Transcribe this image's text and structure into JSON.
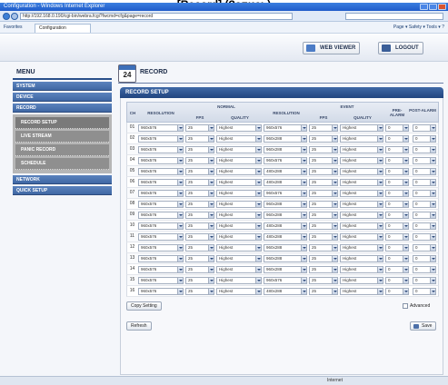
{
  "caption": "[Record] (Запись)",
  "browser": {
    "title": "Configuration - Windows Internet Explorer",
    "address": "http://192.168.0.190/cgi-bin/webra.fcgi?fwcmd=cfg&page=record",
    "favorites_label": "Favorites",
    "tab_label": "Configuration",
    "tools_label": "Page ▾  Safety ▾  Tools ▾  ?",
    "status_text": "Internet"
  },
  "topbar": {
    "web_viewer_label": "WEB VIEWER",
    "logout_label": "LOGOUT"
  },
  "sidebar": {
    "title": "MENU",
    "groups": [
      "SYSTEM",
      "DEVICE",
      "RECORD"
    ],
    "record_items": [
      "RECORD SETUP",
      "LIVE STREAM",
      "PANIC RECORD",
      "SCHEDULE"
    ],
    "after_groups": [
      "NETWORK",
      "QUICK SETUP"
    ]
  },
  "page": {
    "icon_number": "24",
    "title": "RECORD",
    "panel_title": "RECORD SETUP"
  },
  "table": {
    "headers": {
      "ch": "CH",
      "normal": "NORMAL",
      "event": "EVENT",
      "resolution": "RESOLUTION",
      "fps": "FPS",
      "quality": "QUALITY",
      "pre_alarm": "PRE-ALARM",
      "post_alarm": "POST-ALARM"
    },
    "rows": [
      {
        "ch": "01",
        "n_res": "960x576",
        "n_fps": "25",
        "n_q": "Highest",
        "e_res": "960x576",
        "e_fps": "25",
        "e_q": "Highest",
        "pre": "0",
        "post": "0"
      },
      {
        "ch": "02",
        "n_res": "960x576",
        "n_fps": "25",
        "n_q": "Highest",
        "e_res": "960x288",
        "e_fps": "25",
        "e_q": "Highest",
        "pre": "0",
        "post": "0"
      },
      {
        "ch": "03",
        "n_res": "960x576",
        "n_fps": "25",
        "n_q": "Highest",
        "e_res": "960x288",
        "e_fps": "25",
        "e_q": "Highest",
        "pre": "0",
        "post": "0"
      },
      {
        "ch": "04",
        "n_res": "960x576",
        "n_fps": "25",
        "n_q": "Highest",
        "e_res": "960x576",
        "e_fps": "25",
        "e_q": "Highest",
        "pre": "0",
        "post": "0"
      },
      {
        "ch": "05",
        "n_res": "960x576",
        "n_fps": "25",
        "n_q": "Highest",
        "e_res": "480x288",
        "e_fps": "25",
        "e_q": "Highest",
        "pre": "0",
        "post": "0"
      },
      {
        "ch": "06",
        "n_res": "960x576",
        "n_fps": "25",
        "n_q": "Highest",
        "e_res": "480x288",
        "e_fps": "25",
        "e_q": "Highest",
        "pre": "0",
        "post": "0"
      },
      {
        "ch": "07",
        "n_res": "960x576",
        "n_fps": "25",
        "n_q": "Highest",
        "e_res": "960x576",
        "e_fps": "25",
        "e_q": "Highest",
        "pre": "0",
        "post": "0"
      },
      {
        "ch": "08",
        "n_res": "960x576",
        "n_fps": "25",
        "n_q": "Highest",
        "e_res": "960x288",
        "e_fps": "25",
        "e_q": "Highest",
        "pre": "0",
        "post": "0"
      },
      {
        "ch": "09",
        "n_res": "960x576",
        "n_fps": "25",
        "n_q": "Highest",
        "e_res": "960x288",
        "e_fps": "25",
        "e_q": "Highest",
        "pre": "0",
        "post": "0"
      },
      {
        "ch": "10",
        "n_res": "960x576",
        "n_fps": "25",
        "n_q": "Highest",
        "e_res": "480x288",
        "e_fps": "25",
        "e_q": "Highest",
        "pre": "0",
        "post": "0"
      },
      {
        "ch": "11",
        "n_res": "960x576",
        "n_fps": "25",
        "n_q": "Highest",
        "e_res": "480x288",
        "e_fps": "25",
        "e_q": "Highest",
        "pre": "0",
        "post": "0"
      },
      {
        "ch": "12",
        "n_res": "960x576",
        "n_fps": "25",
        "n_q": "Highest",
        "e_res": "960x288",
        "e_fps": "25",
        "e_q": "Highest",
        "pre": "0",
        "post": "0"
      },
      {
        "ch": "13",
        "n_res": "960x576",
        "n_fps": "25",
        "n_q": "Highest",
        "e_res": "960x288",
        "e_fps": "25",
        "e_q": "Highest",
        "pre": "0",
        "post": "0"
      },
      {
        "ch": "14",
        "n_res": "960x576",
        "n_fps": "25",
        "n_q": "Highest",
        "e_res": "960x288",
        "e_fps": "25",
        "e_q": "Highest",
        "pre": "0",
        "post": "0"
      },
      {
        "ch": "15",
        "n_res": "960x576",
        "n_fps": "25",
        "n_q": "Highest",
        "e_res": "960x576",
        "e_fps": "25",
        "e_q": "Highest",
        "pre": "0",
        "post": "0"
      },
      {
        "ch": "16",
        "n_res": "960x576",
        "n_fps": "25",
        "n_q": "Highest",
        "e_res": "480x288",
        "e_fps": "25",
        "e_q": "Highest",
        "pre": "0",
        "post": "0"
      }
    ]
  },
  "buttons": {
    "copy_setting": "Copy Setting",
    "advanced": "Advanced",
    "refresh": "Refresh",
    "save": "Save"
  },
  "colors": {
    "accent": "#21457f",
    "menu_blue": "#3f67a4",
    "submenu_gray": "#8f8f8f"
  }
}
